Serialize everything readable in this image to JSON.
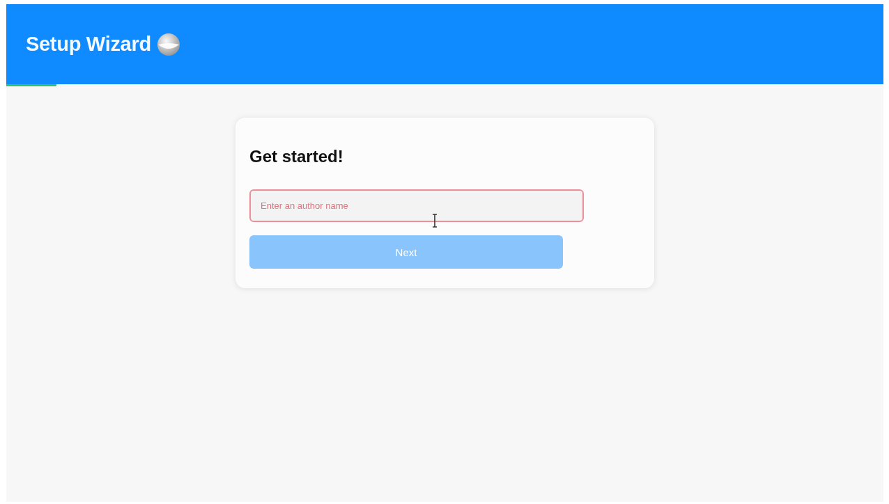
{
  "header": {
    "title": "Setup Wizard"
  },
  "progress": {
    "level": 0.057
  },
  "card": {
    "heading": "Get started!",
    "author_field": {
      "placeholder": "Enter an author name",
      "invalid": true
    },
    "next_button": {
      "label": "Next",
      "disabled": true
    }
  }
}
